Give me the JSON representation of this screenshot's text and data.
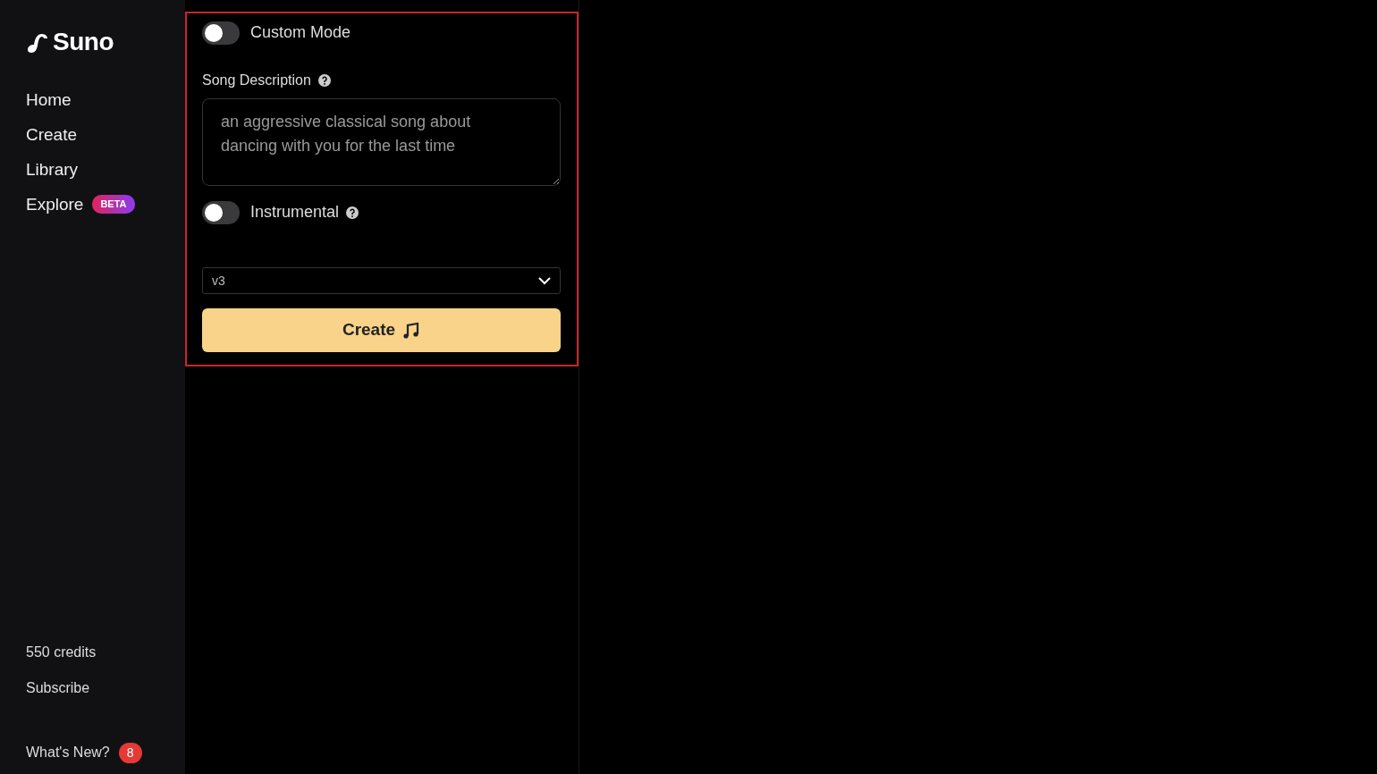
{
  "sidebar": {
    "logo": "Suno",
    "items": [
      {
        "label": "Home"
      },
      {
        "label": "Create"
      },
      {
        "label": "Library"
      },
      {
        "label": "Explore",
        "badge": "BETA"
      }
    ],
    "credits": "550 credits",
    "subscribe": "Subscribe",
    "whats_new": {
      "label": "What's New?",
      "count": "8"
    }
  },
  "form": {
    "highlighted": true,
    "custom_mode": {
      "label": "Custom Mode",
      "on": false
    },
    "song_description": {
      "label": "Song Description",
      "value": "an aggressive classical song about dancing with you for the last time"
    },
    "instrumental": {
      "label": "Instrumental",
      "on": false
    },
    "model": {
      "value": "v3"
    },
    "create_button": "Create"
  }
}
